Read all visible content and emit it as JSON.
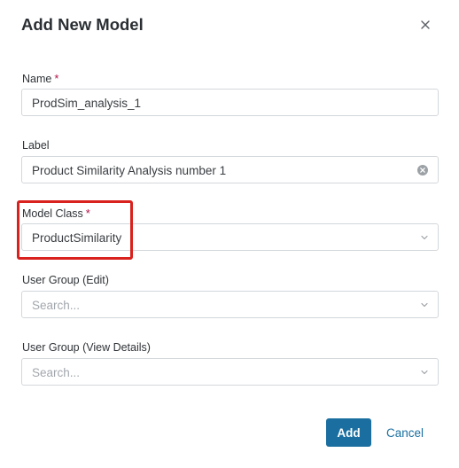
{
  "dialog": {
    "title": "Add New Model",
    "required_marker": "*"
  },
  "fields": {
    "name": {
      "label": "Name",
      "value": "ProdSim_analysis_1"
    },
    "label": {
      "label": "Label",
      "value": "Product Similarity Analysis number 1"
    },
    "model_class": {
      "label": "Model Class",
      "value": "ProductSimilarity"
    },
    "user_group_edit": {
      "label": "User Group (Edit)",
      "placeholder": "Search..."
    },
    "user_group_view": {
      "label": "User Group (View Details)",
      "placeholder": "Search..."
    }
  },
  "buttons": {
    "add_label": "Add",
    "cancel_label": "Cancel"
  },
  "icons": {
    "close": "close-icon",
    "clear": "clear-icon",
    "dropdown": "chevron-down-icon"
  },
  "colors": {
    "primary": "#1a6fa0",
    "required": "#b3124b",
    "highlight": "#d9211d"
  }
}
